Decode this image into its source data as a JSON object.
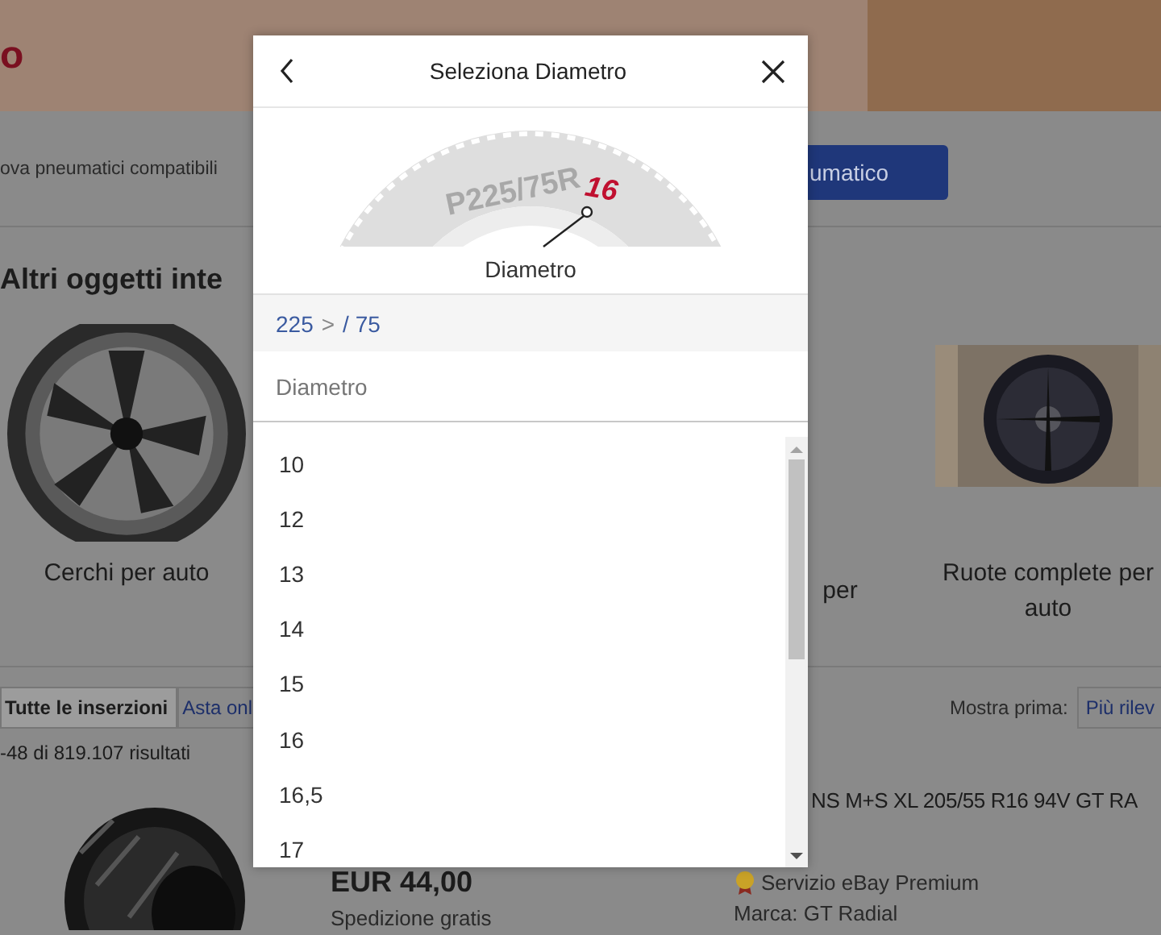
{
  "page": {
    "banner": {
      "logo_fragment": "o"
    },
    "finder": {
      "text": "ova pneumatici compatibili",
      "button": "umatico"
    },
    "section_title": "Altri oggetti inte",
    "categories": [
      {
        "kind": "picture",
        "label": "Cerchi per auto"
      },
      {
        "kind": "text",
        "label": "per"
      },
      {
        "kind": "picture",
        "label": "Ruote complete per auto"
      }
    ],
    "tabs": [
      {
        "label": "Tutte le inserzioni",
        "selected": true
      },
      {
        "label": "Asta onl",
        "selected": false
      }
    ],
    "sort": {
      "label": "Mostra prima:",
      "value": "Più rilev"
    },
    "results_count": "-48 di 819.107 risultati",
    "listing": {
      "title": "NS M+S XL 205/55 R16 94V GT RA",
      "price": "EUR 44,00",
      "shipping": "Spedizione gratis",
      "service": "Servizio eBay Premium",
      "brand": "Marca: GT Radial"
    }
  },
  "dialog": {
    "title": "Seleziona Diametro",
    "tire_size": "P225/75R",
    "tire_highlight": "16",
    "caption": "Diametro",
    "breadcrumb": [
      "225",
      "/ 75"
    ],
    "separator": ">",
    "field": {
      "placeholder": "Diametro"
    },
    "options": [
      "10",
      "12",
      "13",
      "14",
      "15",
      "16",
      "16,5",
      "17"
    ]
  }
}
